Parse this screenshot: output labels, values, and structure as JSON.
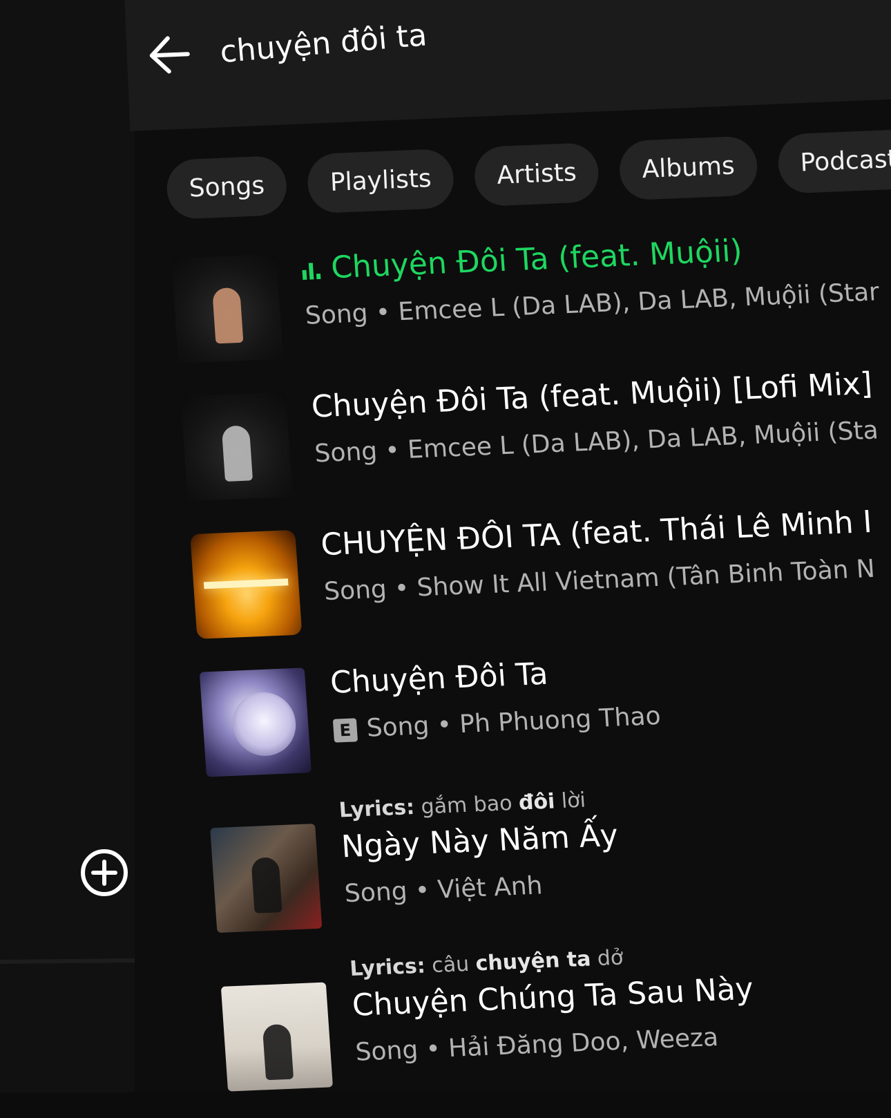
{
  "colors": {
    "background": "#0c0c0c",
    "surface": "#1b1b1b",
    "chip": "#242424",
    "text_primary": "#ffffff",
    "text_secondary": "#b3b3b3",
    "accent_playing": "#1ed760"
  },
  "search": {
    "query": "chuyện đôi ta",
    "back_icon": "arrow-left-icon"
  },
  "tabs": [
    {
      "label": "Songs"
    },
    {
      "label": "Playlists"
    },
    {
      "label": "Artists"
    },
    {
      "label": "Albums"
    },
    {
      "label": "Podcast"
    }
  ],
  "sidebar": {
    "add_icon": "plus-circle-icon"
  },
  "results": [
    {
      "title": "Chuyện Đôi Ta (feat. Muộii)",
      "meta": "Song • Emcee L (Da LAB), Da LAB, Muộii (Star",
      "playing": true,
      "playing_icon": "equalizer-icon"
    },
    {
      "title": "Chuyện Đôi Ta (feat. Muộii) [Lofi Mix]",
      "meta": "Song • Emcee L (Da LAB), Da LAB, Muộii (Sta"
    },
    {
      "title": "CHUYỆN ĐÔI TA (feat. Thái Lê Minh I",
      "meta": "Song • Show It All Vietnam (Tân Binh Toàn N"
    },
    {
      "title": "Chuyện Đôi Ta",
      "explicit_badge": "E",
      "meta": "Song • Ph Phuong Thao"
    },
    {
      "lyrics_label": "Lyrics:",
      "lyrics_pre": "gắm bao",
      "lyrics_hl": "đôi",
      "lyrics_post": "lời",
      "title": "Ngày Này Năm Ấy",
      "meta": "Song • Việt Anh"
    },
    {
      "lyrics_label": "Lyrics:",
      "lyrics_pre": "câu",
      "lyrics_hl": "chuyện ta",
      "lyrics_post": "dở",
      "title": "Chuyện Chúng Ta Sau Này",
      "meta": "Song • Hải Đăng Doo, Weeza"
    }
  ]
}
